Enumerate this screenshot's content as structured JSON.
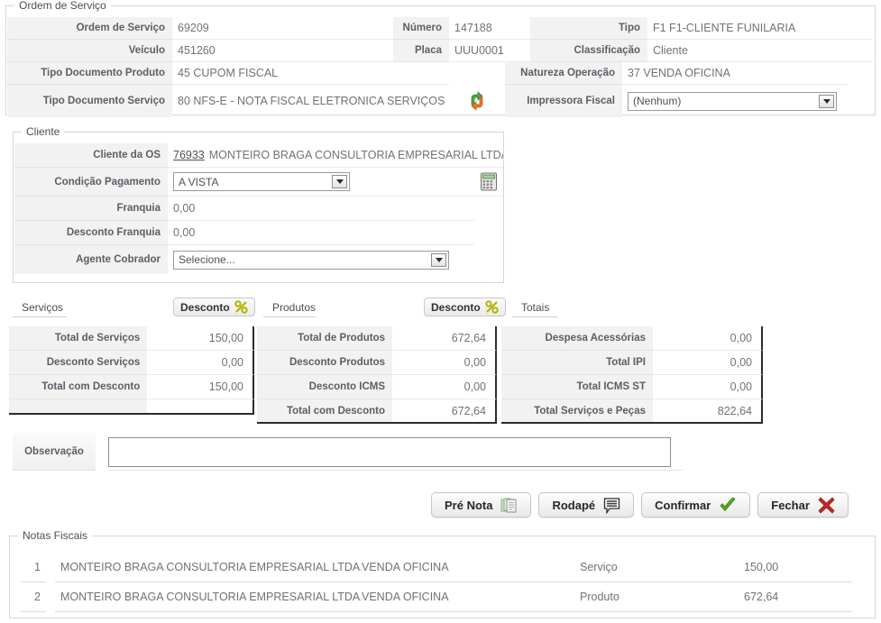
{
  "ordem_servico": {
    "legend": "Ordem de Serviço",
    "rows": [
      {
        "label1": "Ordem de Serviço",
        "value1": "69209",
        "label2": "Número",
        "value2": "147188",
        "label3": "Tipo",
        "value3": "F1  F1-CLIENTE FUNILARIA"
      },
      {
        "label1": "Veículo",
        "value1": "451260",
        "label2": "Placa",
        "value2": "UUU0001",
        "label3": "Classificação",
        "value3": "Cliente"
      },
      {
        "label1": "Tipo Documento Produto",
        "value1": "45  CUPOM FISCAL",
        "label2": "",
        "value2": "",
        "label3": "Natureza Operação",
        "value3": "37  VENDA OFICINA"
      },
      {
        "label1": "Tipo Documento Serviço",
        "value1": "80  NFS-E - NOTA FISCAL ELETRONICA SERVIÇOS",
        "label2": "",
        "value2": "",
        "label3": "Impressora Fiscal",
        "value3": ""
      }
    ],
    "swap_icon": "swap-arrows-icon",
    "impressora_fiscal": {
      "selected": "(Nenhum)"
    }
  },
  "cliente": {
    "legend": "Cliente",
    "cliente_os": {
      "label": "Cliente da OS",
      "code": "76933",
      "name": "MONTEIRO BRAGA CONSULTORIA EMPRESARIAL LTDA."
    },
    "condicao_pagamento": {
      "label": "Condição Pagamento",
      "selected": "A VISTA"
    },
    "calculator_icon": "calculator-icon",
    "franquia": {
      "label": "Franquia",
      "value": "0,00"
    },
    "desconto_franquia": {
      "label": "Desconto Franquia",
      "value": "0,00"
    },
    "agente_cobrador": {
      "label": "Agente Cobrador",
      "selected": "Selecione..."
    }
  },
  "tabs": {
    "servicos": "Serviços",
    "produtos": "Produtos",
    "totais": "Totais",
    "desconto_servicos_btn": "Desconto",
    "desconto_produtos_btn": "Desconto",
    "percent_icon": "percent-icon"
  },
  "totais_servicos": {
    "rows": [
      {
        "label": "Total de Serviços",
        "value": "150,00"
      },
      {
        "label": "Desconto Serviços",
        "value": "0,00"
      },
      {
        "label": "Total com Desconto",
        "value": "150,00"
      },
      {
        "label": "",
        "value": ""
      }
    ]
  },
  "totais_produtos": {
    "rows": [
      {
        "label": "Total de Produtos",
        "value": "672,64"
      },
      {
        "label": "Desconto Produtos",
        "value": "0,00"
      },
      {
        "label": "Desconto ICMS",
        "value": "0,00"
      },
      {
        "label": "Total com Desconto",
        "value": "672,64"
      }
    ]
  },
  "totais_gerais": {
    "rows": [
      {
        "label": "Despesa Acessórias",
        "value": "0,00"
      },
      {
        "label": "Total IPI",
        "value": "0,00"
      },
      {
        "label": "Total ICMS ST",
        "value": "0,00"
      },
      {
        "label": "Total Serviços e Peças",
        "value": "822,64"
      }
    ]
  },
  "observacao": {
    "label": "Observação",
    "value": ""
  },
  "buttons": {
    "pre_nota": {
      "label": "Pré Nota",
      "icon": "documents-icon"
    },
    "rodape": {
      "label": "Rodapé",
      "icon": "comment-icon"
    },
    "confirmar": {
      "label": "Confirmar",
      "icon": "check-icon"
    },
    "fechar": {
      "label": "Fechar",
      "icon": "close-x-icon"
    }
  },
  "notas_fiscais": {
    "legend": "Notas Fiscais",
    "rows": [
      {
        "index": "1",
        "cliente": "MONTEIRO BRAGA CONSULTORIA EMPRESARIAL LTDA.",
        "natureza": "VENDA OFICINA",
        "tipo": "Serviço",
        "valor": "150,00"
      },
      {
        "index": "2",
        "cliente": "MONTEIRO BRAGA CONSULTORIA EMPRESARIAL LTDA.",
        "natureza": "VENDA OFICINA",
        "tipo": "Produto",
        "valor": "672,64"
      }
    ]
  },
  "colors": {
    "label_bg": "#f2f2f2",
    "text": "#6d7378",
    "accent_dark": "#2c2c2c",
    "check_green": "#5aa633",
    "close_red": "#c0392b",
    "percent_olive": "#b5b200"
  }
}
